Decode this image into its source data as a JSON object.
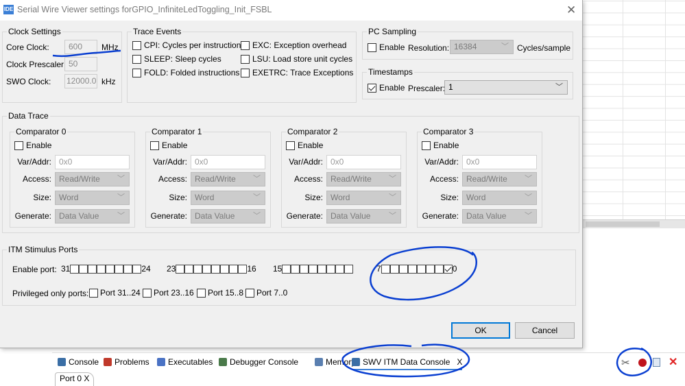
{
  "dialog": {
    "title": "Serial Wire Viewer settings forGPIO_InfiniteLedToggling_Init_FSBL",
    "icon_text": "IDE",
    "close_icon": "close-icon",
    "clock": {
      "title": "Clock Settings",
      "core_label": "Core Clock:",
      "core_value": "600",
      "core_unit": "MHz",
      "prescaler_label": "Clock Prescaler:",
      "prescaler_value": "50",
      "swo_label": "SWO Clock:",
      "swo_value": "12000.0",
      "swo_unit": "kHz"
    },
    "trace": {
      "title": "Trace Events",
      "items": [
        {
          "label": "CPI: Cycles per instruction",
          "checked": false
        },
        {
          "label": "SLEEP: Sleep cycles",
          "checked": false
        },
        {
          "label": "FOLD: Folded instructions",
          "checked": false
        },
        {
          "label": "EXC: Exception overhead",
          "checked": false
        },
        {
          "label": "LSU: Load store unit cycles",
          "checked": false
        },
        {
          "label": "EXETRC: Trace Exceptions",
          "checked": false
        }
      ]
    },
    "pc": {
      "title": "PC Sampling",
      "enable_label": "Enable",
      "enabled": false,
      "resolution_label": "Resolution:",
      "resolution_value": "16384",
      "unit": "Cycles/sample"
    },
    "timestamps": {
      "title": "Timestamps",
      "enable_label": "Enable",
      "enabled": true,
      "prescaler_label": "Prescaler:",
      "prescaler_value": "1"
    },
    "data_trace": {
      "title": "Data Trace",
      "comparators": [
        {
          "title": "Comparator 0",
          "enable": "Enable",
          "var_label": "Var/Addr:",
          "var": "0x0",
          "access_label": "Access:",
          "access": "Read/Write",
          "size_label": "Size:",
          "size": "Word",
          "generate_label": "Generate:",
          "generate": "Data Value"
        },
        {
          "title": "Comparator 1",
          "enable": "Enable",
          "var_label": "Var/Addr:",
          "var": "0x0",
          "access_label": "Access:",
          "access": "Read/Write",
          "size_label": "Size:",
          "size": "Word",
          "generate_label": "Generate:",
          "generate": "Data Value"
        },
        {
          "title": "Comparator 2",
          "enable": "Enable",
          "var_label": "Var/Addr:",
          "var": "0x0",
          "access_label": "Access:",
          "access": "Read/Write",
          "size_label": "Size:",
          "size": "Word",
          "generate_label": "Generate:",
          "generate": "Data Value"
        },
        {
          "title": "Comparator 3",
          "enable": "Enable",
          "var_label": "Var/Addr:",
          "var": "0x0",
          "access_label": "Access:",
          "access": "Read/Write",
          "size_label": "Size:",
          "size": "Word",
          "generate_label": "Generate:",
          "generate": "Data Value"
        }
      ]
    },
    "itm": {
      "title": "ITM Stimulus Ports",
      "enable_label": "Enable port:",
      "groups": [
        {
          "hi": "31",
          "lo": "24",
          "checked": [
            false,
            false,
            false,
            false,
            false,
            false,
            false,
            false
          ]
        },
        {
          "hi": "23",
          "lo": "16",
          "checked": [
            false,
            false,
            false,
            false,
            false,
            false,
            false,
            false
          ]
        },
        {
          "hi": "15",
          "lo": "",
          "checked": [
            false,
            false,
            false,
            false,
            false,
            false,
            false,
            false
          ]
        },
        {
          "hi": "7",
          "lo": "0",
          "checked": [
            false,
            false,
            false,
            false,
            false,
            false,
            false,
            true
          ]
        }
      ],
      "privileged_label": "Privileged only ports:",
      "privileged": [
        {
          "label": "Port 31..24",
          "checked": false
        },
        {
          "label": "Port 23..16",
          "checked": false
        },
        {
          "label": "Port 15..8",
          "checked": false
        },
        {
          "label": "Port 7..0",
          "checked": false
        }
      ]
    },
    "ok": "OK",
    "cancel": "Cancel"
  },
  "console": {
    "tabs": [
      {
        "label": "Console",
        "icon": "console-icon",
        "color": "#3a6ea5"
      },
      {
        "label": "Problems",
        "icon": "problems-icon",
        "color": "#c0392b"
      },
      {
        "label": "Executables",
        "icon": "executables-icon",
        "color": "#4a72c4"
      },
      {
        "label": "Debugger Console",
        "icon": "debugger-console-icon",
        "color": "#4a7a4a"
      },
      {
        "label": "Memory",
        "icon": "memory-icon",
        "color": "#5a7fb0"
      },
      {
        "label": "SWV ITM Data Console",
        "icon": "swv-console-icon",
        "color": "#3a6ea5",
        "active": true,
        "close": "X"
      }
    ],
    "port_tab": "Port 0",
    "port_tab_close": "X",
    "toolbar": [
      "configure-trace-icon",
      "start-trace-icon",
      "save-icon",
      "remove-icon"
    ]
  },
  "colors": {
    "annotation": "#0a3fd1",
    "focus": "#0078d7"
  }
}
